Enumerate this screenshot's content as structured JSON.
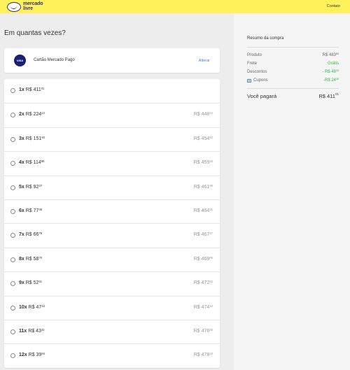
{
  "header": {
    "logo_line1": "mercado",
    "logo_line2": "livre",
    "contact": "Contato",
    "colors": {
      "background": "#fff159",
      "logo": "#2d3277"
    }
  },
  "main": {
    "title": "Em quantas vezes?",
    "card": {
      "brand": "VISA",
      "name": "Cartão Mercado Pago",
      "change": "Alterar"
    },
    "options": [
      {
        "count": "1x",
        "amount": "R$ 411",
        "cents": "01",
        "total": "",
        "total_cents": ""
      },
      {
        "count": "2x",
        "amount": "R$ 224",
        "cents": "12",
        "total": "R$ 448",
        "total_cents": "24"
      },
      {
        "count": "3x",
        "amount": "R$ 151",
        "cents": "60",
        "total": "R$ 454",
        "total_cents": "82"
      },
      {
        "count": "4x",
        "amount": "R$ 114",
        "cents": "88",
        "total": "R$ 459",
        "total_cents": "46"
      },
      {
        "count": "5x",
        "amount": "R$ 92",
        "cents": "37",
        "total": "R$ 461",
        "total_cents": "89"
      },
      {
        "count": "6x",
        "amount": "R$ 77",
        "cents": "38",
        "total": "R$ 464",
        "total_cents": "31"
      },
      {
        "count": "7x",
        "amount": "R$ 66",
        "cents": "78",
        "total": "R$ 467",
        "total_cents": "47"
      },
      {
        "count": "8x",
        "amount": "R$ 58",
        "cents": "70",
        "total": "R$ 469",
        "total_cents": "66"
      },
      {
        "count": "9x",
        "amount": "R$ 52",
        "cents": "51",
        "total": "R$ 472",
        "total_cents": "62"
      },
      {
        "count": "10x",
        "amount": "R$ 47",
        "cents": "43",
        "total": "R$ 474",
        "total_cents": "34"
      },
      {
        "count": "11x",
        "amount": "R$ 43",
        "cents": "32",
        "total": "R$ 476",
        "total_cents": "60"
      },
      {
        "count": "12x",
        "amount": "R$ 39",
        "cents": "84",
        "total": "R$ 478",
        "total_cents": "16"
      }
    ]
  },
  "summary": {
    "title": "Resumo da compra",
    "product_label": "Produto",
    "product_value": "R$ 483",
    "product_cents": "84",
    "shipping_label": "Frete",
    "shipping_value": "Grátis",
    "discounts_label": "Descontos",
    "discounts_value": "- R$ 48",
    "discounts_cents": "35",
    "coupons_label": "Cupons",
    "coupons_value": "-R$ 24",
    "coupons_cents": "38",
    "total_label": "Você pagará",
    "total_value": "R$ 411",
    "total_cents": "01",
    "colors": {
      "green": "#39b54a",
      "link": "#3483fa"
    }
  }
}
